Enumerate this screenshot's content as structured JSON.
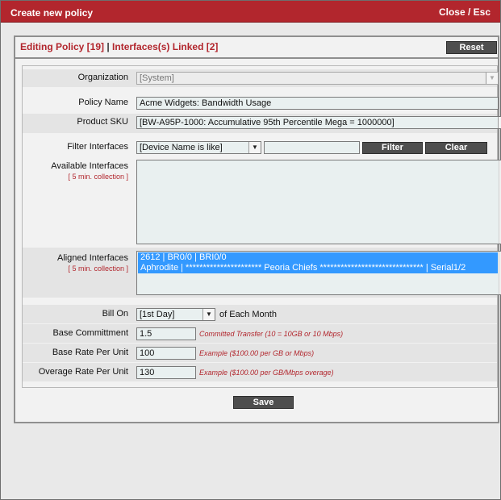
{
  "dialog": {
    "title": "Create new policy",
    "close_label": "Close / Esc"
  },
  "header": {
    "editing_label": "Editing Policy [19]",
    "separator": " | ",
    "linked_label": "Interfaces(s) Linked [2]",
    "reset_label": "Reset"
  },
  "form": {
    "organization": {
      "label": "Organization",
      "value": "[System]"
    },
    "policy_name": {
      "label": "Policy Name",
      "value": "Acme Widgets: Bandwidth Usage"
    },
    "product_sku": {
      "label": "Product SKU",
      "value": "[BW-A95P-1000: Accumulative 95th Percentile Mega = 1000000]"
    },
    "filter_interfaces": {
      "label": "Filter Interfaces",
      "selected": "[Device Name is like]",
      "text_value": "",
      "filter_label": "Filter",
      "clear_label": "Clear"
    },
    "available_interfaces": {
      "label": "Available Interfaces",
      "sub": "[ 5 min. collection ]",
      "items": []
    },
    "aligned_interfaces": {
      "label": "Aligned Interfaces",
      "sub": "[ 5 min. collection ]",
      "items": [
        "2612 | BR0/0 | BRI0/0",
        "Aphrodite | ********************** Peoria Chiefs ****************************** | Serial1/2"
      ]
    },
    "bill_on": {
      "label": "Bill On",
      "selected": "[1st Day]",
      "suffix": "of Each Month"
    },
    "base_commitment": {
      "label": "Base Committment",
      "value": "1.5",
      "hint": "Committed Transfer (10 = 10GB or 10 Mbps)"
    },
    "base_rate": {
      "label": "Base Rate Per Unit",
      "value": "100",
      "hint": "Example ($100.00 per GB or Mbps)"
    },
    "overage_rate": {
      "label": "Overage Rate Per Unit",
      "value": "130",
      "hint": "Example ($100.00 per GB/Mbps overage)"
    }
  },
  "footer": {
    "save_label": "Save"
  }
}
